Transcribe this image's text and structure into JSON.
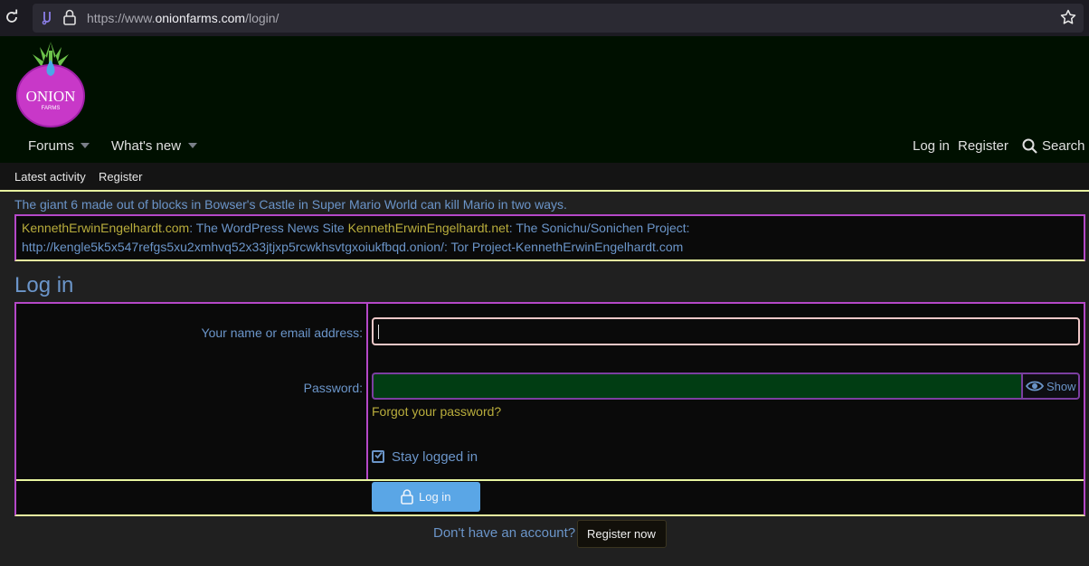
{
  "browser": {
    "url_prefix": "https://www.",
    "url_domain": "onionfarms.com",
    "url_path": "/login/"
  },
  "logo": {
    "text_main": "ONION",
    "text_sub": "FARMS"
  },
  "nav": {
    "forums": "Forums",
    "whats_new": "What's new",
    "login": "Log in",
    "register": "Register",
    "search": "Search"
  },
  "subnav": {
    "latest_activity": "Latest activity",
    "register": "Register"
  },
  "notice": "The giant 6 made out of blocks in Bowser's Castle in Super Mario World can kill Mario in two ways.",
  "links": {
    "l1_gold": "KennethErwinEngelhardt.com",
    "l1_blue": ": The WordPress News Site ",
    "l2_gold": "KennethErwinEngelhardt.net",
    "l2_blue": ": The Sonichu/Sonichen Project:",
    "line2": "http://kengle5k5x547refgs5xu2xmhvq52x33jtjxp5rcwkhsvtgxoiukfbqd.onion/: Tor Project-KennethErwinEngelhardt.com"
  },
  "page_title": "Log in",
  "form": {
    "username_label": "Your name or email address:",
    "username_value": "",
    "password_label": "Password:",
    "password_value": "",
    "show_label": "Show",
    "forgot": "Forgot your password?",
    "stay_logged_in": "Stay logged in",
    "stay_checked": true,
    "submit": "Log in"
  },
  "footer": {
    "no_account": "Don't have an account?",
    "register_now": "Register now"
  },
  "colors": {
    "accent_blue": "#6b95c9",
    "gold": "#b9ad3c",
    "purple_border": "#b548c8",
    "yellow_border": "#e8f5a0",
    "button_blue": "#5aa6e6"
  }
}
